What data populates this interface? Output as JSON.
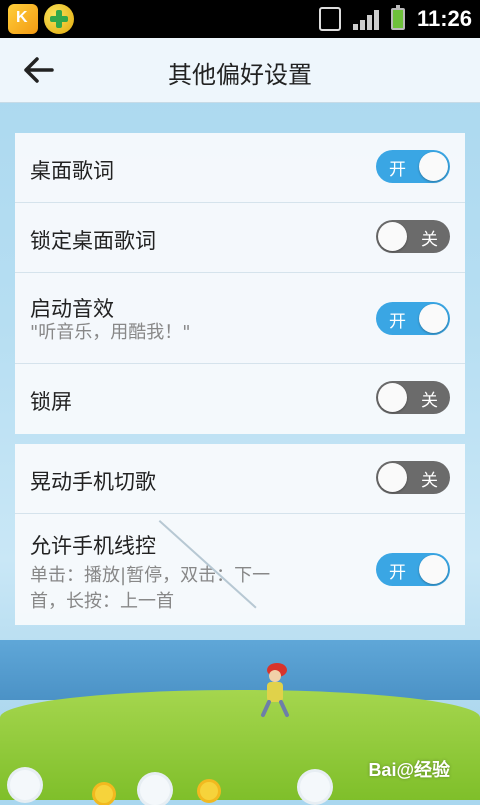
{
  "status_bar": {
    "time": "11:26"
  },
  "header": {
    "title": "其他偏好设置"
  },
  "groups": [
    {
      "items": [
        {
          "label": "桌面歌词",
          "toggle": {
            "on": true,
            "text": "开"
          }
        },
        {
          "label": "锁定桌面歌词",
          "toggle": {
            "on": false,
            "text": "关"
          }
        },
        {
          "label": "启动音效",
          "sub": "\"听音乐，用酷我！\"",
          "toggle": {
            "on": true,
            "text": "开"
          }
        },
        {
          "label": "锁屏",
          "toggle": {
            "on": false,
            "text": "关"
          }
        }
      ]
    },
    {
      "items": [
        {
          "label": "晃动手机切歌",
          "toggle": {
            "on": false,
            "text": "关"
          }
        },
        {
          "label": "允许手机线控",
          "sub_line1": "单击：播放|暂停，双击：下一",
          "sub_line2": "首，长按：上一首",
          "toggle": {
            "on": true,
            "text": "开"
          }
        }
      ]
    }
  ],
  "watermark": "Bai@经验",
  "colors": {
    "toggle_on": "#3aa6e4",
    "toggle_off": "#6b6b6b"
  }
}
